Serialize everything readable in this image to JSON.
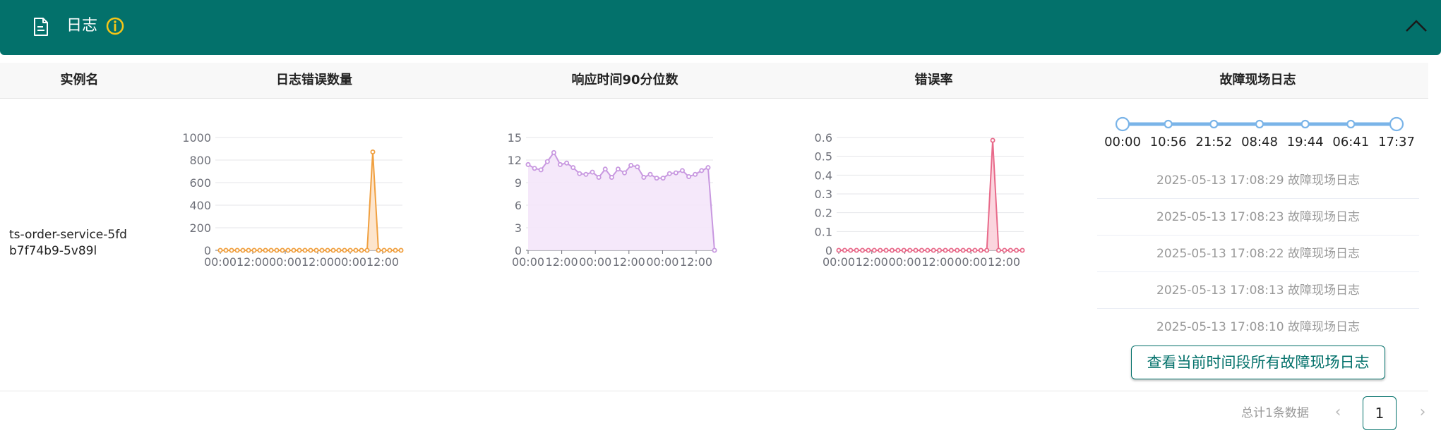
{
  "header": {
    "title": "日志",
    "icons": {
      "document": "document-icon",
      "info": "info-icon",
      "collapse": "chevron-up-icon"
    },
    "colors": {
      "background": "#03716b",
      "info": "#f5c518"
    }
  },
  "table": {
    "columns": [
      "实例名",
      "日志错误数量",
      "响应时间90分位数",
      "错误率",
      "故障现场日志"
    ],
    "rows": [
      {
        "instance": "ts-order-service-5fdb7f74b9-5v89l"
      }
    ]
  },
  "chart_data": [
    {
      "type": "area",
      "color": "#f0a040",
      "fill": "#fde2c8",
      "yticks": [
        "0",
        "200",
        "400",
        "600",
        "800",
        "1000"
      ],
      "xticks": [
        "00:00",
        "12:00",
        "00:00",
        "12:00",
        "00:00",
        "12:00"
      ],
      "ylim": [
        0,
        1000
      ],
      "values": [
        0,
        0,
        0,
        0,
        0,
        0,
        0,
        0,
        0,
        0,
        0,
        0,
        0,
        0,
        0,
        0,
        0,
        0,
        0,
        0,
        0,
        0,
        0,
        0,
        0,
        0,
        0,
        872,
        0,
        0,
        0,
        0,
        0
      ]
    },
    {
      "type": "area",
      "color": "#c898e0",
      "fill": "#f4e6fa",
      "yticks": [
        "0",
        "3",
        "6",
        "9",
        "12",
        "15"
      ],
      "xticks": [
        "00:00",
        "12:00",
        "00:00",
        "12:00",
        "00:00",
        "12:00"
      ],
      "ylim": [
        0,
        15
      ],
      "values": [
        11.4,
        10.9,
        10.7,
        11.8,
        13.0,
        11.4,
        11.6,
        11.0,
        10.2,
        10.1,
        10.4,
        9.7,
        10.8,
        9.7,
        10.8,
        10.3,
        11.3,
        11.1,
        9.7,
        10.1,
        9.6,
        9.6,
        10.2,
        10.3,
        10.6,
        9.8,
        10.1,
        10.6,
        11.0,
        0
      ]
    },
    {
      "type": "area",
      "color": "#e86a8a",
      "fill": "#fbd0da",
      "yticks": [
        "0",
        "0.1",
        "0.2",
        "0.3",
        "0.4",
        "0.5",
        "0.6"
      ],
      "xticks": [
        "00:00",
        "12:00",
        "00:00",
        "12:00",
        "00:00",
        "12:00"
      ],
      "ylim": [
        0,
        0.6
      ],
      "values": [
        0,
        0,
        0,
        0,
        0,
        0,
        0,
        0,
        0,
        0,
        0,
        0,
        0,
        0,
        0,
        0,
        0,
        0,
        0,
        0,
        0,
        0,
        0,
        0,
        0,
        0,
        0.585,
        0,
        0,
        0,
        0,
        0
      ]
    }
  ],
  "timeline": {
    "labels": [
      "00:00",
      "10:56",
      "21:52",
      "08:48",
      "19:44",
      "06:41",
      "17:37"
    ],
    "color": "#7ab4e8"
  },
  "fault_logs": [
    "2025-05-13 17:08:29 故障现场日志",
    "2025-05-13 17:08:23 故障现场日志",
    "2025-05-13 17:08:22 故障现场日志",
    "2025-05-13 17:08:13 故障现场日志",
    "2025-05-13 17:08:10 故障现场日志"
  ],
  "view_all_button": "查看当前时间段所有故障现场日志",
  "pagination": {
    "total": "总计1条数据",
    "current": "1",
    "prev": "‹",
    "next": "›"
  }
}
